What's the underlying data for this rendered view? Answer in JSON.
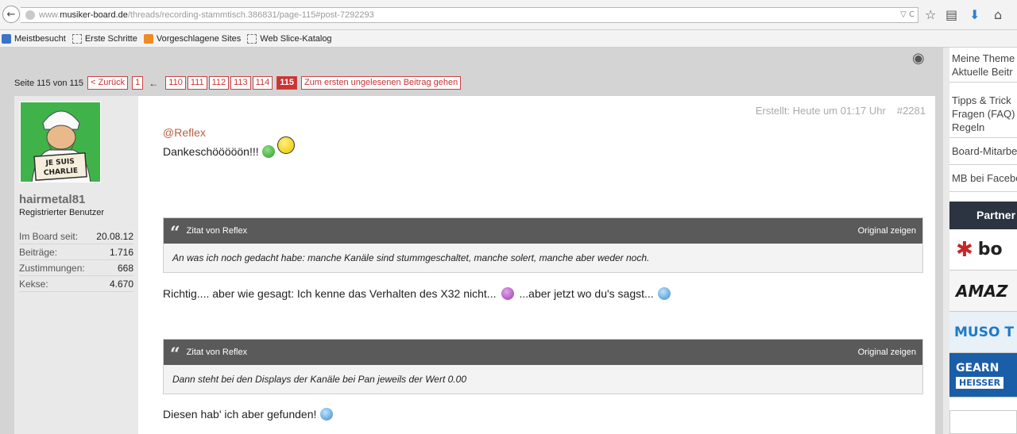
{
  "browser": {
    "url_prefix": "www.",
    "url_domain": "musiker-board.de",
    "url_path": "/threads/recording-stammtisch.386831/page-115#post-7292293",
    "url_actions": "▽ C",
    "bookmarks": [
      {
        "label": "Meistbesucht",
        "icon": "blue"
      },
      {
        "label": "Erste Schritte",
        "icon": "box"
      },
      {
        "label": "Vorgeschlagene Sites",
        "icon": "orange"
      },
      {
        "label": "Web Slice-Katalog",
        "icon": "box"
      }
    ]
  },
  "pagination": {
    "label": "Seite 115 von 115",
    "prev": "< Zurück",
    "first": "1",
    "arrow": "←",
    "pages": [
      "110",
      "111",
      "112",
      "113",
      "114"
    ],
    "current": "115",
    "first_unread": "Zum ersten ungelesenen Beitrag gehen"
  },
  "author": {
    "avatar_line1": "JE SUIS",
    "avatar_line2": "CHARLIE",
    "username": "hairmetal81",
    "title": "Registrierter Benutzer",
    "stats": [
      {
        "label": "Im Board seit:",
        "value": "20.08.12"
      },
      {
        "label": "Beiträge:",
        "value": "1.716"
      },
      {
        "label": "Zustimmungen:",
        "value": "668"
      },
      {
        "label": "Kekse:",
        "value": "4.670"
      }
    ]
  },
  "post": {
    "created": "Erstellt: Heute um 01:17 Uhr",
    "number": "#2281",
    "mention": "@Reflex",
    "thanks": "Dankeschööööön!!!",
    "quotes": [
      {
        "by": "Zitat von Reflex",
        "show": "Original zeigen",
        "text": "An was ich noch gedacht habe: manche Kanäle sind stummgeschaltet, manche solert, manche aber weder noch."
      },
      {
        "by": "Zitat von Reflex",
        "show": "Original zeigen",
        "text": "Dann steht bei den Displays der Kanäle bei Pan jeweils der Wert 0.00"
      }
    ],
    "reply1_a": "Richtig.... aber wie gesagt: Ich kenne das Verhalten des X32 nicht...",
    "reply1_b": "...aber jetzt wo du's sagst...",
    "reply2": "Diesen hab' ich aber gefunden!"
  },
  "sidebar": {
    "links1": [
      "Meine Theme",
      "Aktuelle Beitr"
    ],
    "links2": [
      "Tipps & Trick",
      "Fragen (FAQ)",
      "Regeln"
    ],
    "link3": "Board-Mitarbe",
    "link4": "MB bei Facebo",
    "partner_head": "Partner",
    "logos": [
      "bo",
      "AMAZ",
      "MUSO T",
      "GEARN",
      "HEISSER"
    ]
  },
  "colors": {
    "pagination_accent": "#cc3333",
    "mention": "#b56040",
    "quote_header": "#5a5a5a",
    "partner_header": "#2b3440"
  }
}
